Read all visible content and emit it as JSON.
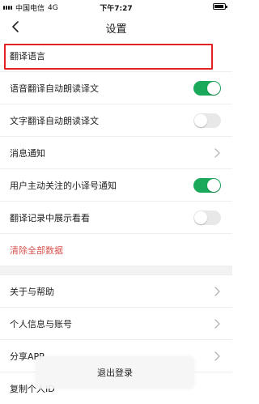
{
  "status_bar": {
    "carrier": "中国电信",
    "network": "4G",
    "time": "下午7:27"
  },
  "nav": {
    "title": "设置"
  },
  "colors": {
    "accent": "#1aa85a",
    "danger": "#d9534f",
    "highlight": "#e02222"
  },
  "settings": {
    "translate_language": "翻译语言",
    "voice_auto_read": {
      "label": "语音翻译自动朗读译文",
      "on": true
    },
    "text_auto_read": {
      "label": "文字翻译自动朗读译文",
      "on": false
    },
    "notifications": "消息通知",
    "followed_account_notify": {
      "label": "用户主动关注的小译号通知",
      "on": true
    },
    "show_history": {
      "label": "翻译记录中展示看看",
      "on": false
    },
    "clear_data": "清除全部数据",
    "about_help": "关于与帮助",
    "personal_info": "个人信息与账号",
    "share_app": "分享APP",
    "copy_id": "复制个人ID"
  },
  "toast": {
    "text": "退出登录"
  }
}
